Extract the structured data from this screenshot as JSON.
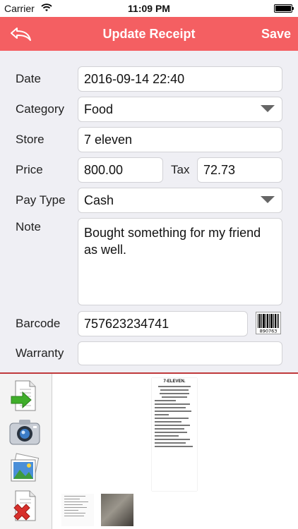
{
  "status_bar": {
    "carrier": "Carrier",
    "time": "11:09 PM",
    "battery_level": 1.0
  },
  "navbar": {
    "title": "Update Receipt",
    "save_label": "Save",
    "back_icon": "back-arrow-icon"
  },
  "form": {
    "date": {
      "label": "Date",
      "value": "2016-09-14 22:40"
    },
    "category": {
      "label": "Category",
      "value": "Food"
    },
    "store": {
      "label": "Store",
      "value": "7 eleven"
    },
    "price": {
      "label": "Price",
      "value": "800.00"
    },
    "tax": {
      "label": "Tax",
      "value": "72.73"
    },
    "pay_type": {
      "label": "Pay Type",
      "value": "Cash"
    },
    "note": {
      "label": "Note",
      "value": "Bought something for my friend\nas well."
    },
    "barcode": {
      "label": "Barcode",
      "value": "757623234741",
      "scan_icon_digits": "890763"
    },
    "warranty": {
      "label": "Warranty",
      "value": ""
    }
  },
  "receipt_preview": {
    "header": "7-ELEVEN."
  },
  "tools": [
    "import-document-icon",
    "camera-icon",
    "photo-library-icon",
    "delete-document-icon"
  ],
  "colors": {
    "accent": "#f45f62",
    "divider": "#c0393b",
    "background": "#efeff4"
  }
}
